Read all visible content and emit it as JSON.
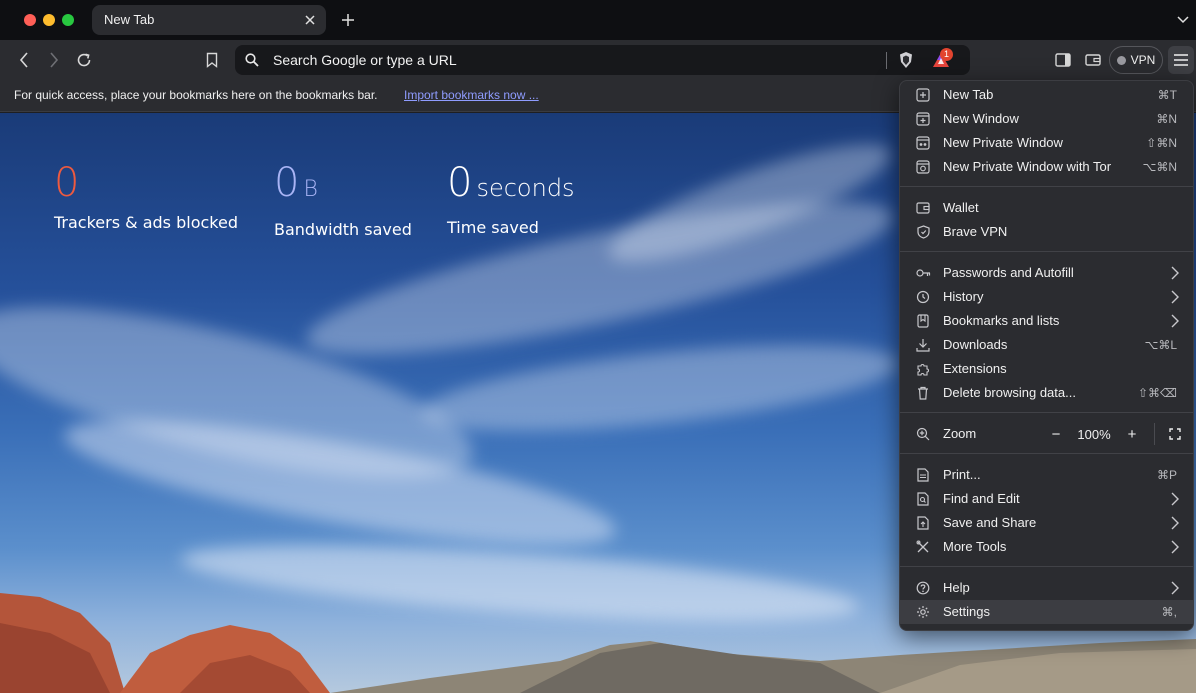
{
  "tab": {
    "title": "New Tab"
  },
  "omnibox": {
    "placeholder": "Search Google or type a URL",
    "rewards_badge": "1"
  },
  "vpn": {
    "label": "VPN"
  },
  "bookmarks_bar": {
    "text": "For quick access, place your bookmarks here on the bookmarks bar.",
    "link": "Import bookmarks now ..."
  },
  "stats": [
    {
      "value": "0",
      "unit": "",
      "label": "Trackers & ads blocked",
      "color": "#ee5a3f"
    },
    {
      "value": "0",
      "unit": "B",
      "label": "Bandwidth saved",
      "color": "#a9b4f5"
    },
    {
      "value": "0",
      "unit": "seconds",
      "label": "Time saved",
      "color": "#ffffff"
    }
  ],
  "menu": {
    "new_tab": {
      "label": "New Tab",
      "shortcut": "⌘T"
    },
    "new_window": {
      "label": "New Window",
      "shortcut": "⌘N"
    },
    "new_private_window": {
      "label": "New Private Window",
      "shortcut": "⇧⌘N"
    },
    "new_private_window_tor": {
      "label": "New Private Window with Tor",
      "shortcut": "⌥⌘N"
    },
    "wallet": {
      "label": "Wallet"
    },
    "brave_vpn": {
      "label": "Brave VPN"
    },
    "passwords": {
      "label": "Passwords and Autofill"
    },
    "history": {
      "label": "History"
    },
    "bookmarks": {
      "label": "Bookmarks and lists"
    },
    "downloads": {
      "label": "Downloads",
      "shortcut": "⌥⌘L"
    },
    "extensions": {
      "label": "Extensions"
    },
    "delete_data": {
      "label": "Delete browsing data...",
      "shortcut": "⇧⌘⌫"
    },
    "zoom": {
      "label": "Zoom",
      "minus": "−",
      "value": "100%",
      "plus": "+"
    },
    "print": {
      "label": "Print...",
      "shortcut": "⌘P"
    },
    "find_edit": {
      "label": "Find and Edit"
    },
    "save_share": {
      "label": "Save and Share"
    },
    "more_tools": {
      "label": "More Tools"
    },
    "help": {
      "label": "Help"
    },
    "settings": {
      "label": "Settings",
      "shortcut": "⌘,"
    }
  }
}
